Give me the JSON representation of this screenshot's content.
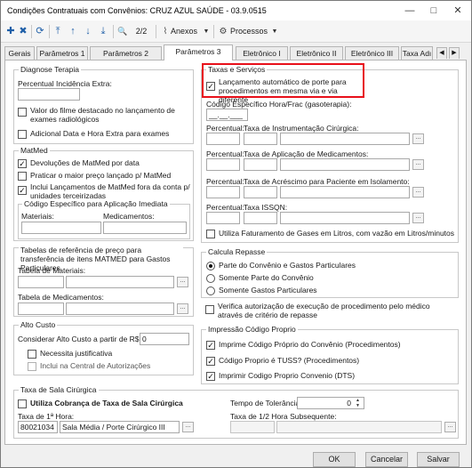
{
  "window": {
    "title": "Condições Contratuais com Convênios: CRUZ AZUL SAÚDE - 03.9.0515",
    "minimize": "—",
    "maximize": "□",
    "close": "✕"
  },
  "toolbar": {
    "new": "✚",
    "delete": "✖",
    "refresh": "⟳",
    "first": "⤒",
    "prev": "↑",
    "next": "↓",
    "last": "⤓",
    "search": "🔍",
    "pager": "2/2",
    "attachments": "Anexos",
    "processes": "Processos"
  },
  "tabs": [
    "Gerais",
    "Parâmetros 1",
    "Parâmetros 2",
    "Parâmetros 3",
    "Eletrônico I",
    "Eletrônico II",
    "Eletrônico III",
    "Taxa Adı"
  ],
  "active_tab": 3,
  "diag": {
    "title": "Diagnose Terapia",
    "pct_film_label": "Percentual Incidência Extra:",
    "pct_film_value": "",
    "film_highlight": "Valor do filme destacado no lançamento de exames radiológicos",
    "extra_date": "Adicional Data e Hora Extra para exames"
  },
  "matmed": {
    "title": "MatMed",
    "devolucoes": "Devoluções de MatMed por data",
    "praticar": "Praticar o maior preço lançado p/ MatMed",
    "incluir": "Inclui Lançamentos de MatMed fora da conta p/ unidades terceirizadas",
    "cod_title": "Código Específico para Aplicação Imediata",
    "materiais": "Materiais:",
    "medicamentos": "Medicamentos:"
  },
  "tabelas": {
    "title": "Tabelas de referência de preço para transferência de itens MATMED para Gastos Particulares",
    "materiais": "Tabela de Materiais:",
    "medicamentos": "Tabela de Medicamentos:"
  },
  "alto": {
    "title": "Alto Custo",
    "considerar": "Considerar Alto Custo a partir de R$",
    "valor": "0",
    "justificativa": "Necessita justificativa",
    "central": "Inclui na Central de Autorizações"
  },
  "taxas": {
    "title": "Taxas e Serviços",
    "lancamento": "Lançamento automático de porte para procedimentos em mesma via e via diferente",
    "cod_hora": "Código Específico Hora/Frac (gasoterapia):",
    "cod_hora_value": "__.__.___",
    "percentual": "Percentual:",
    "instrumentacao": "Taxa de Instrumentação Cirúrgica:",
    "aplicacao": "Taxa de Aplicação de Medicamentos:",
    "acrescimo": "Taxa de Acréscimo para Paciente em Isolamento:",
    "issqn": "Taxa ISSQN:",
    "gases": "Utiliza Faturamento de Gases em Litros, com vazão em Litros/minutos"
  },
  "repasse": {
    "title": "Calcula Repasse",
    "op1": "Parte do Convênio e Gastos Particulares",
    "op2": "Somente Parte do Convênio",
    "op3": "Somente Gastos Particulares",
    "verifica": "Verifica autorização de execução de procedimento pelo médico através de critério de repasse"
  },
  "impressao": {
    "title": "Impressão Código Proprio",
    "op1": "Imprime Código Próprio do Convênio (Procedimentos)",
    "op2": "Código Proprio é TUSS? (Procedimentos)",
    "op3": "Imprimir Codigo Proprio Convenio (DTS)"
  },
  "sala": {
    "title": "Taxa de Sala Cirúrgica",
    "utiliza": "Utiliza Cobrança de Taxa de Sala Cirúrgica",
    "tempo": "Tempo de Tolerância:",
    "tempo_value": "0",
    "taxa1": "Taxa de 1ª Hora:",
    "taxa1_code": "80021034",
    "taxa1_desc": "Sala Média / Porte Cirúrgico III",
    "taxa_half": "Taxa de 1/2 Hora Subsequente:"
  },
  "buttons": {
    "ok": "OK",
    "cancel": "Cancelar",
    "save": "Salvar"
  },
  "colors": {
    "accent": "#1f5fa8",
    "highlight": "#e8101a"
  }
}
